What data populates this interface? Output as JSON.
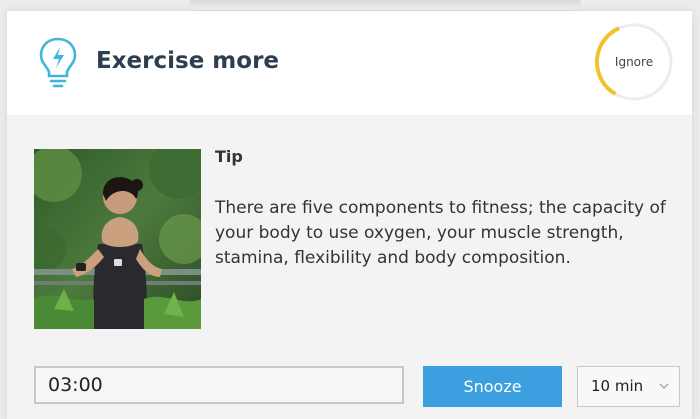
{
  "header": {
    "title": "Exercise more",
    "ignore_label": "Ignore",
    "ignore_timer_progress": 0.35,
    "icon": "lightbulb-icon"
  },
  "tip": {
    "heading": "Tip",
    "body": "There are five components to fitness; the capacity of your body to use oxygen, your muscle strength, stamina, flexibility and body composition."
  },
  "controls": {
    "timer_value": "03:00",
    "snooze_label": "Snooze",
    "duration_selected": "10 min"
  },
  "colors": {
    "accent": "#3c9fdf",
    "ring_progress": "#f2c12e",
    "ring_track": "#ececec",
    "bulb": "#3fb6d9"
  }
}
